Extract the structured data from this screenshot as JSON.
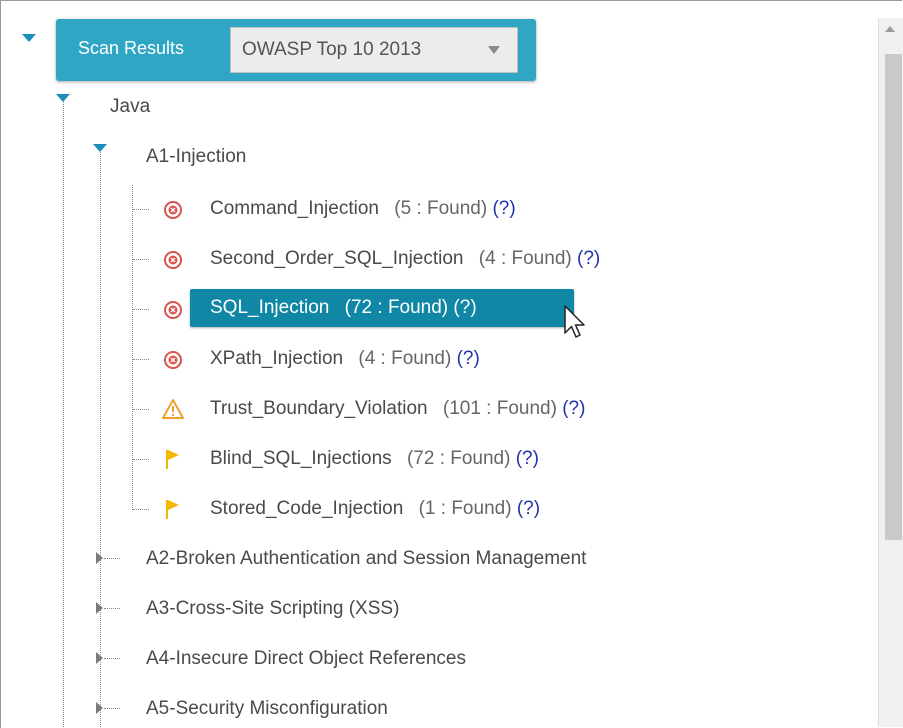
{
  "header": {
    "title": "Scan Results",
    "dropdown_value": "OWASP Top 10 2013"
  },
  "tree": {
    "language": "Java",
    "categories": [
      {
        "label": "A1-Injection",
        "items": [
          {
            "name": "Command_Injection",
            "count": "(5 : Found)",
            "help": "(?)",
            "severity": "high"
          },
          {
            "name": "Second_Order_SQL_Injection",
            "count": "(4 : Found)",
            "help": "(?)",
            "severity": "high"
          },
          {
            "name": "SQL_Injection",
            "count": "(72 : Found)",
            "help": "(?)",
            "severity": "high",
            "selected": true
          },
          {
            "name": "XPath_Injection",
            "count": "(4 : Found)",
            "help": "(?)",
            "severity": "high"
          },
          {
            "name": "Trust_Boundary_Violation",
            "count": "(101 : Found)",
            "help": "(?)",
            "severity": "medium"
          },
          {
            "name": "Blind_SQL_Injections",
            "count": "(72 : Found)",
            "help": "(?)",
            "severity": "low"
          },
          {
            "name": "Stored_Code_Injection",
            "count": "(1 : Found)",
            "help": "(?)",
            "severity": "low"
          }
        ]
      },
      {
        "label": "A2-Broken Authentication and Session Management"
      },
      {
        "label": "A3-Cross-Site Scripting (XSS)"
      },
      {
        "label": "A4-Insecure Direct Object References"
      },
      {
        "label": "A5-Security Misconfiguration"
      }
    ]
  },
  "colors": {
    "accent": "#2fa6c3",
    "selected": "#1187a6",
    "high_severity": "#d9534f",
    "medium_severity": "#f0a030",
    "low_severity": "#f5b800",
    "help_link": "#2233aa"
  }
}
